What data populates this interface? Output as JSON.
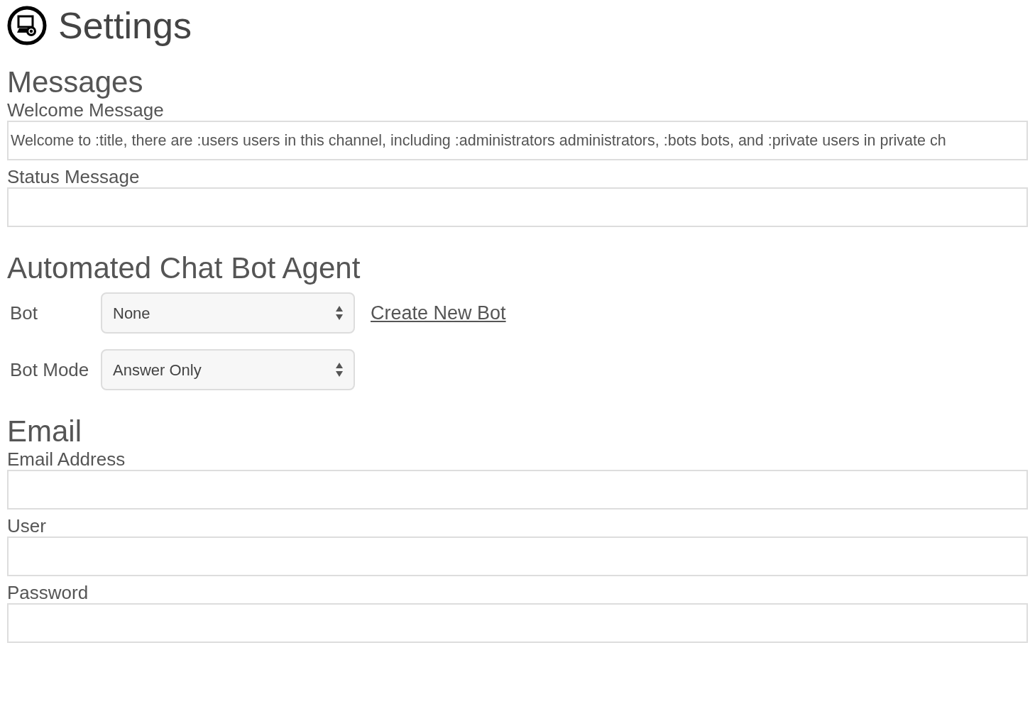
{
  "title": "Settings",
  "sections": [
    {
      "heading": "Messages",
      "kind": "stacked",
      "fields": [
        {
          "kind": "text",
          "label": "Welcome Message",
          "value": "Welcome to :title, there are :users users in this channel, including :administrators administrators, :bots bots, and :private users in private ch"
        },
        {
          "kind": "text",
          "label": "Status Message"
        }
      ]
    },
    {
      "heading": "Automated Chat Bot Agent",
      "kind": "inline",
      "fields": [
        {
          "kind": "select",
          "label": "Bot",
          "value": "None",
          "link": "Create New Bot"
        },
        {
          "kind": "select",
          "label": "Bot Mode",
          "value": "Answer Only"
        }
      ]
    },
    {
      "heading": "Email",
      "kind": "stacked",
      "fields": [
        {
          "kind": "text",
          "label": "Email Address"
        },
        {
          "kind": "text",
          "label": "User"
        },
        {
          "kind": "text",
          "label": "Password"
        }
      ]
    }
  ]
}
